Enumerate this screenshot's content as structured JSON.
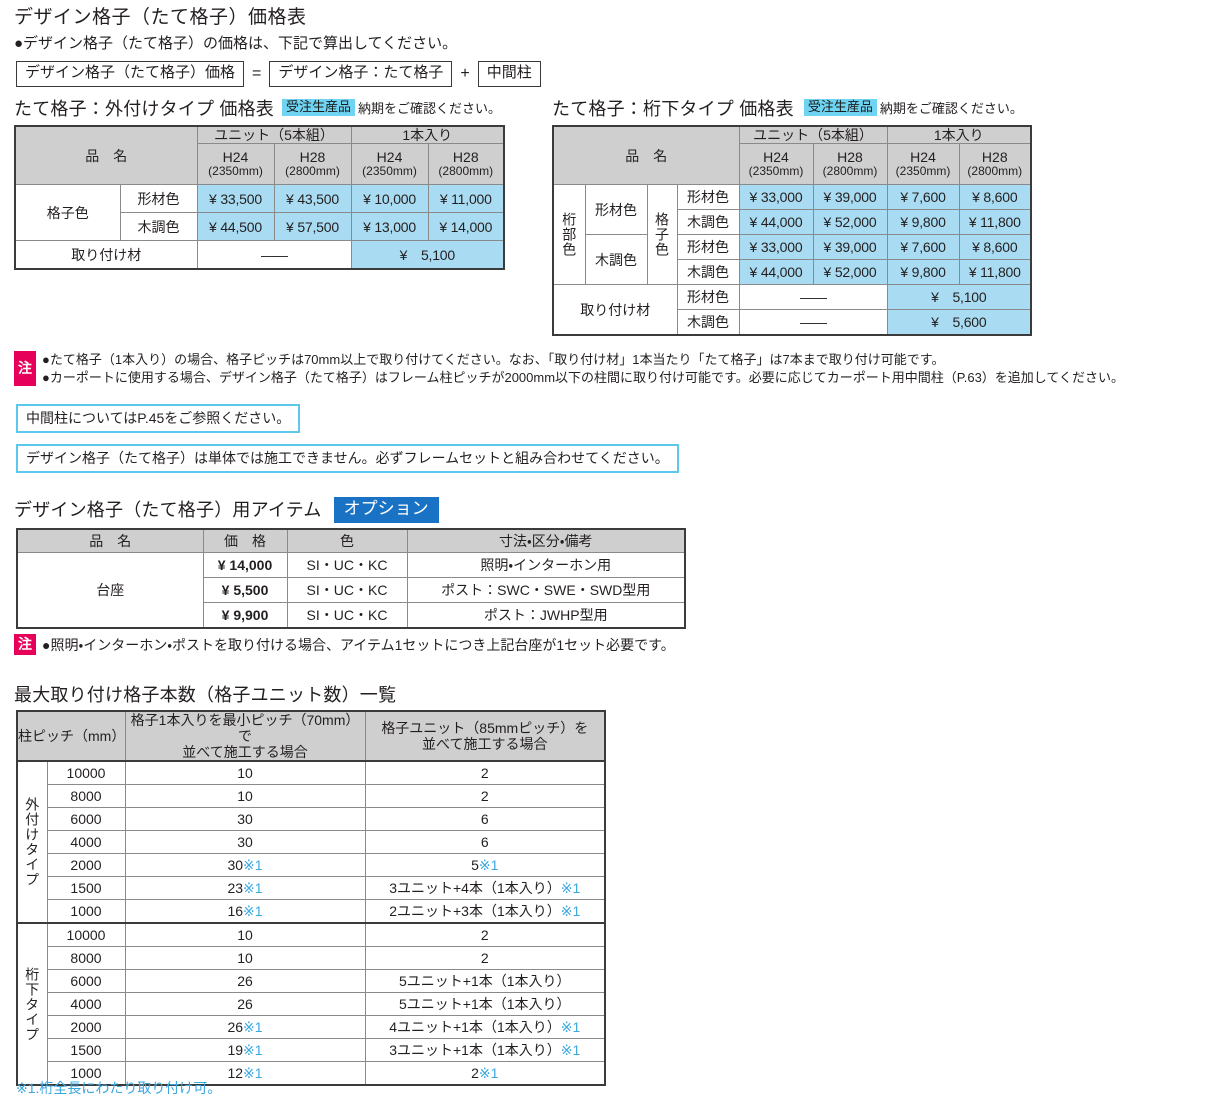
{
  "header": {
    "title": "デザイン格子（たて格子）価格表",
    "lead": "●デザイン格子（たて格子）の価格は、下記で算出してください。",
    "formula": {
      "result": "デザイン格子（たて格子）価格",
      "equals": "=",
      "term1": "デザイン格子：たて格子",
      "plus": "+",
      "term2": "中間柱"
    }
  },
  "table_outer": {
    "title": "たて格子：外付けタイプ 価格表",
    "badge": "受注生産品",
    "badge_note": "納期をご確認ください。",
    "headers": {
      "name": "品　名",
      "unit": "ユニット（5本組）",
      "single": "1本入り",
      "h24": "H24",
      "h24_mm": "(2350mm)",
      "h28": "H28",
      "h28_mm": "(2800mm)"
    },
    "row_group_label": "格子色",
    "rows": [
      {
        "label": "形材色",
        "unit_h24": "¥ 33,500",
        "unit_h28": "¥ 43,500",
        "single_h24": "¥ 10,000",
        "single_h28": "¥ 11,000"
      },
      {
        "label": "木調色",
        "unit_h24": "¥ 44,500",
        "unit_h28": "¥ 57,500",
        "single_h24": "¥ 13,000",
        "single_h28": "¥ 14,000"
      }
    ],
    "mount_label": "取り付け材",
    "mount_unit": "——",
    "mount_single": "¥　5,100"
  },
  "table_under": {
    "title": "たて格子：桁下タイプ 価格表",
    "badge": "受注生産品",
    "badge_note": "納期をご確認ください。",
    "headers": {
      "name": "品　名",
      "unit": "ユニット（5本組）",
      "single": "1本入り",
      "h24": "H24",
      "h24_mm": "(2350mm)",
      "h28": "H28",
      "h28_mm": "(2800mm)"
    },
    "beam_color_label": "桁部色",
    "lattice_color_label": "格子色",
    "groups": [
      {
        "beam": "形材色",
        "rows": [
          {
            "label": "形材色",
            "unit_h24": "¥ 33,000",
            "unit_h28": "¥ 39,000",
            "single_h24": "¥  7,600",
            "single_h28": "¥  8,600"
          },
          {
            "label": "木調色",
            "unit_h24": "¥ 44,000",
            "unit_h28": "¥ 52,000",
            "single_h24": "¥  9,800",
            "single_h28": "¥ 11,800"
          }
        ]
      },
      {
        "beam": "木調色",
        "rows": [
          {
            "label": "形材色",
            "unit_h24": "¥ 33,000",
            "unit_h28": "¥ 39,000",
            "single_h24": "¥  7,600",
            "single_h28": "¥  8,600"
          },
          {
            "label": "木調色",
            "unit_h24": "¥ 44,000",
            "unit_h28": "¥ 52,000",
            "single_h24": "¥  9,800",
            "single_h28": "¥ 11,800"
          }
        ]
      }
    ],
    "mount_label": "取り付け材",
    "mount_rows": [
      {
        "label": "形材色",
        "unit": "——",
        "single": "¥　5,100"
      },
      {
        "label": "木調色",
        "unit": "——",
        "single": "¥　5,600"
      }
    ]
  },
  "notes_main": {
    "label": "注",
    "lines": [
      "●たて格子（1本入り）の場合、格子ピッチは70mm以上で取り付けてください。なお、「取り付け材」1本当たり「たて格子」は7本まで取り付け可能です。",
      "●カーポートに使用する場合、デザイン格子（たて格子）はフレーム柱ピッチが2000mm以下の柱間に取り付け可能です。必要に応じてカーポート用中間柱（P.63）を追加してください。"
    ]
  },
  "callouts": [
    "中間柱についてはP.45をご参照ください。",
    "デザイン格子（たて格子）は単体では施工できません。必ずフレームセットと組み合わせてください。"
  ],
  "options": {
    "title": "デザイン格子（たて格子）用アイテム",
    "badge": "オプション",
    "headers": [
      "品　名",
      "価　格",
      "色",
      "寸法・区分・備考"
    ],
    "group_label": "台座",
    "rows": [
      {
        "price": "¥ 14,000",
        "color": "SI・UC・KC",
        "remark": "照明・インターホン用"
      },
      {
        "price": "¥  5,500",
        "color": "SI・UC・KC",
        "remark": "ポスト：SWC・SWE・SWD型用"
      },
      {
        "price": "¥  9,900",
        "color": "SI・UC・KC",
        "remark": "ポスト：JWHP型用"
      }
    ],
    "note": {
      "label": "注",
      "text": "●照明・インターホン・ポストを取り付ける場合、アイテム1セットにつき上記台座が1セット必要です。"
    }
  },
  "max_count": {
    "title": "最大取り付け格子本数（格子ユニット数）一覧",
    "headers": {
      "pitch": "柱ピッチ（mm）",
      "single": "格子1本入りを最小ピッチ（70mm）で\n並べて施工する場合",
      "single_l1": "格子1本入りを最小ピッチ（70mm）で",
      "single_l2": "並べて施工する場合",
      "unit_l1": "格子ユニット（85mmピッチ）を",
      "unit_l2": "並べて施工する場合"
    },
    "groups": [
      {
        "type": "外付けタイプ",
        "rows": [
          {
            "pitch": "10000",
            "single": "10",
            "single_mark": "",
            "unit": "2",
            "unit_mark": ""
          },
          {
            "pitch": "8000",
            "single": "10",
            "single_mark": "",
            "unit": "2",
            "unit_mark": ""
          },
          {
            "pitch": "6000",
            "single": "30",
            "single_mark": "",
            "unit": "6",
            "unit_mark": ""
          },
          {
            "pitch": "4000",
            "single": "30",
            "single_mark": "",
            "unit": "6",
            "unit_mark": ""
          },
          {
            "pitch": "2000",
            "single": "30",
            "single_mark": "※1",
            "unit": "5",
            "unit_mark": "※1",
            "unit_blue": true
          },
          {
            "pitch": "1500",
            "single": "23",
            "single_mark": "※1",
            "unit": "3ユニット+4本（1本入り）",
            "unit_mark": "※1"
          },
          {
            "pitch": "1000",
            "single": "16",
            "single_mark": "※1",
            "unit": "2ユニット+3本（1本入り）",
            "unit_mark": "※1"
          }
        ]
      },
      {
        "type": "桁下タイプ",
        "rows": [
          {
            "pitch": "10000",
            "single": "10",
            "single_mark": "",
            "unit": "2",
            "unit_mark": ""
          },
          {
            "pitch": "8000",
            "single": "10",
            "single_mark": "",
            "unit": "2",
            "unit_mark": ""
          },
          {
            "pitch": "6000",
            "single": "26",
            "single_mark": "",
            "unit": "5ユニット+1本（1本入り）",
            "unit_mark": ""
          },
          {
            "pitch": "4000",
            "single": "26",
            "single_mark": "",
            "unit": "5ユニット+1本（1本入り）",
            "unit_mark": ""
          },
          {
            "pitch": "2000",
            "single": "26",
            "single_mark": "※1",
            "unit": "4ユニット+1本（1本入り）",
            "unit_mark": "※1"
          },
          {
            "pitch": "1500",
            "single": "19",
            "single_mark": "※1",
            "unit": "3ユニット+1本（1本入り）",
            "unit_mark": "※1"
          },
          {
            "pitch": "1000",
            "single": "12",
            "single_mark": "※1",
            "unit": "2",
            "unit_mark": "※1",
            "unit_blue": true
          }
        ]
      }
    ],
    "footnote": "※1.桁全長にわたり取り付け可。"
  },
  "colors": {
    "price_cell": "#a9dcf2",
    "header_gray": "#cfcfcf",
    "badge_order": "#6fd3f2",
    "badge_option": "#1a72c4",
    "note_label": "#e6005a",
    "callout_border": "#5ec8ec",
    "blue_text": "#3aa8e0"
  }
}
